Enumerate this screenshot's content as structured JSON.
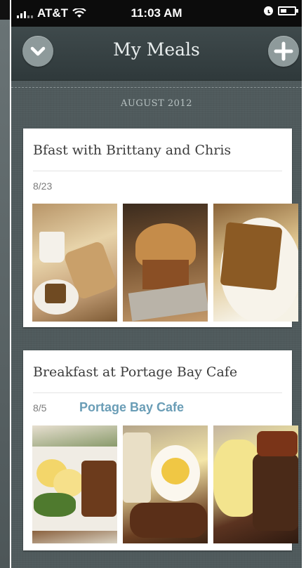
{
  "status_bar": {
    "carrier": "AT&T",
    "time": "11:03 AM"
  },
  "navbar": {
    "title": "My Meals"
  },
  "section_header": "AUGUST 2012",
  "meals": [
    {
      "title": "Bfast with Brittany and Chris",
      "date": "8/23",
      "place": "",
      "photos": [
        "coffee-and-pastries-photo",
        "muffin-photo",
        "pumpkin-bread-photo"
      ]
    },
    {
      "title": "Breakfast at Portage Bay Cafe",
      "date": "8/5",
      "place": "Portage Bay Cafe",
      "photos": [
        "eggs-benedict-photo",
        "breakfast-plate-photo",
        "omelette-toast-photo"
      ]
    }
  ],
  "colors": {
    "background": "#4f5a5c",
    "navbar": "#353f41",
    "place_link": "#6a9db6",
    "button": "#8e9a9b"
  }
}
